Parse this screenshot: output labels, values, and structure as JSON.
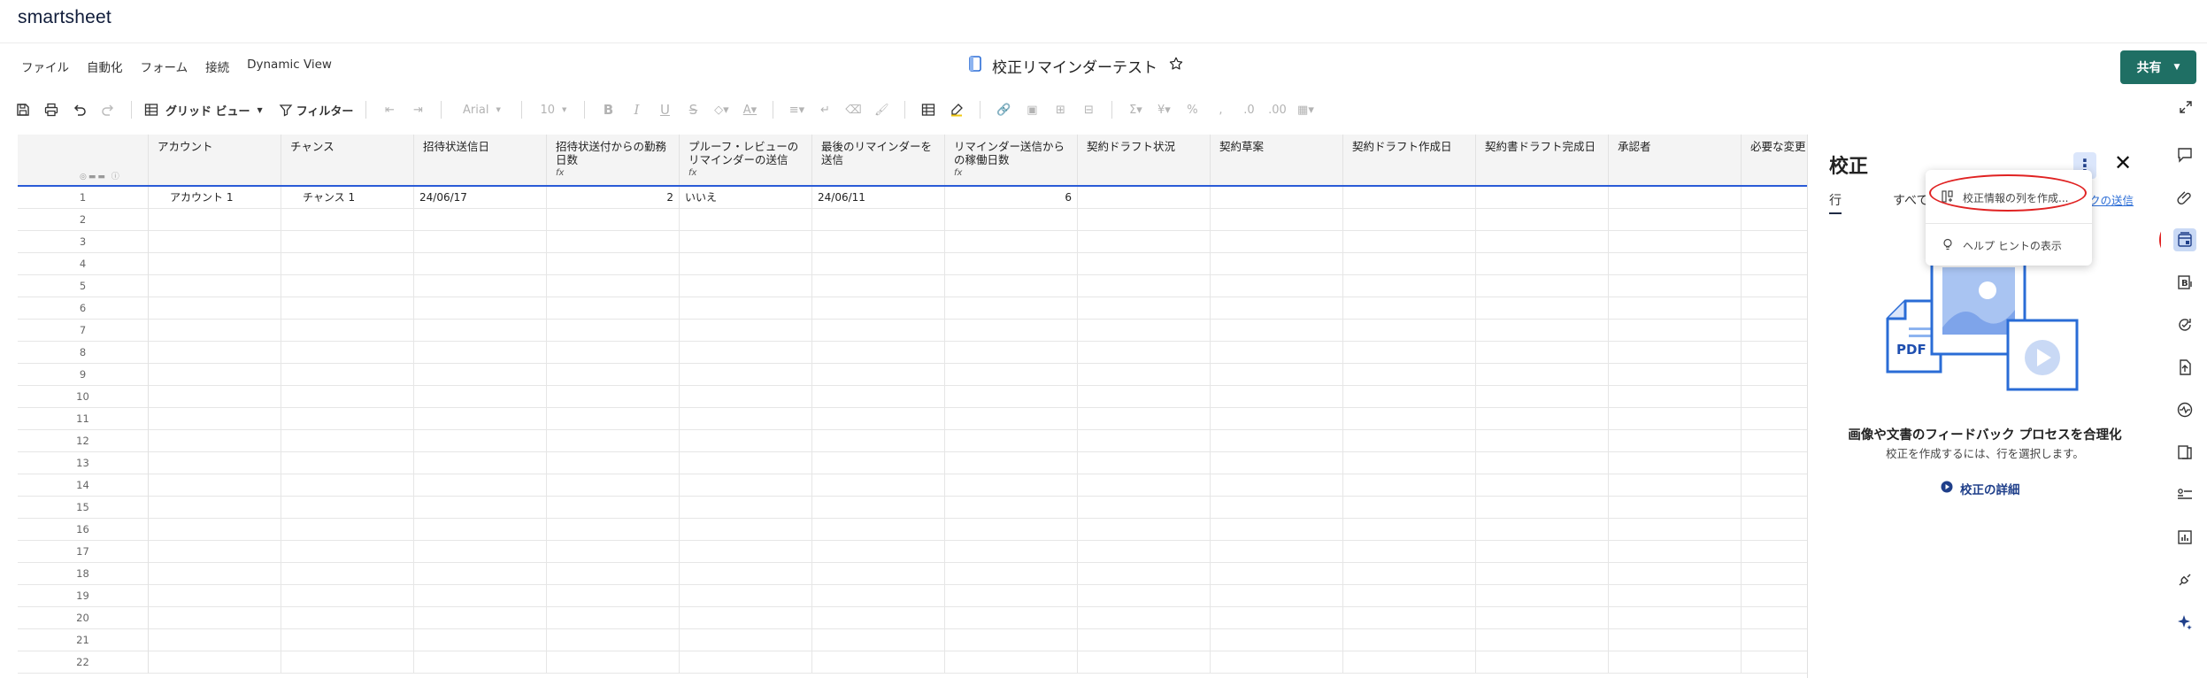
{
  "app": {
    "brand": "smartsheet"
  },
  "menu": {
    "items": [
      "ファイル",
      "自動化",
      "フォーム",
      "接続",
      "Dynamic View"
    ]
  },
  "document": {
    "title": "校正リマインダーテスト"
  },
  "share": {
    "label": "共有"
  },
  "toolbar": {
    "view_label": "グリッド ビュー",
    "filter_label": "フィルター",
    "font_label": "Arial",
    "font_size": "10"
  },
  "grid": {
    "columns": [
      {
        "label": "アカウント"
      },
      {
        "label": "チャンス"
      },
      {
        "label": "招待状送信日"
      },
      {
        "label": "招待状送付からの勤務日数",
        "formula": "fx"
      },
      {
        "label": "プルーフ・レビューのリマインダーの送信",
        "formula": "fx"
      },
      {
        "label": "最後のリマインダーを送信"
      },
      {
        "label": "リマインダー送信からの稼働日数",
        "formula": "fx"
      },
      {
        "label": "契約ドラフト状況"
      },
      {
        "label": "契約草案"
      },
      {
        "label": "契約ドラフト作成日"
      },
      {
        "label": "契約書ドラフト完成日"
      },
      {
        "label": "承認者"
      },
      {
        "label": "必要な変更"
      }
    ],
    "rows": [
      {
        "num": "1",
        "cells": [
          "アカウント 1",
          "チャンス 1",
          "24/06/17",
          "2",
          "いいえ",
          "24/06/11",
          "6",
          "",
          "",
          "",
          "",
          "",
          ""
        ]
      },
      {
        "num": "2"
      },
      {
        "num": "3"
      },
      {
        "num": "4"
      },
      {
        "num": "5"
      },
      {
        "num": "6"
      },
      {
        "num": "7"
      },
      {
        "num": "8"
      },
      {
        "num": "9"
      },
      {
        "num": "10"
      },
      {
        "num": "11"
      },
      {
        "num": "12"
      },
      {
        "num": "13"
      },
      {
        "num": "14"
      },
      {
        "num": "15"
      },
      {
        "num": "16"
      },
      {
        "num": "17"
      },
      {
        "num": "18"
      },
      {
        "num": "19"
      },
      {
        "num": "20"
      },
      {
        "num": "21"
      },
      {
        "num": "22"
      }
    ]
  },
  "panel": {
    "title": "校正",
    "tabs": [
      "行",
      "すべて"
    ],
    "link_fragment": "クの送信",
    "headline": "画像や文書のフィードバック プロセスを合理化",
    "subtext": "校正を作成するには、行を選択します。",
    "more_link": "校正の詳細",
    "pdf_label": "PDF"
  },
  "dropdown": {
    "items": [
      {
        "label": "校正情報の列を作成...",
        "icon": "columns-icon"
      },
      {
        "label": "ヘルプ ヒントの表示",
        "icon": "lightbulb-icon"
      }
    ]
  },
  "colors": {
    "accent": "#1f6f64",
    "selection": "#2a5bd7",
    "annotation": "#e02222"
  }
}
